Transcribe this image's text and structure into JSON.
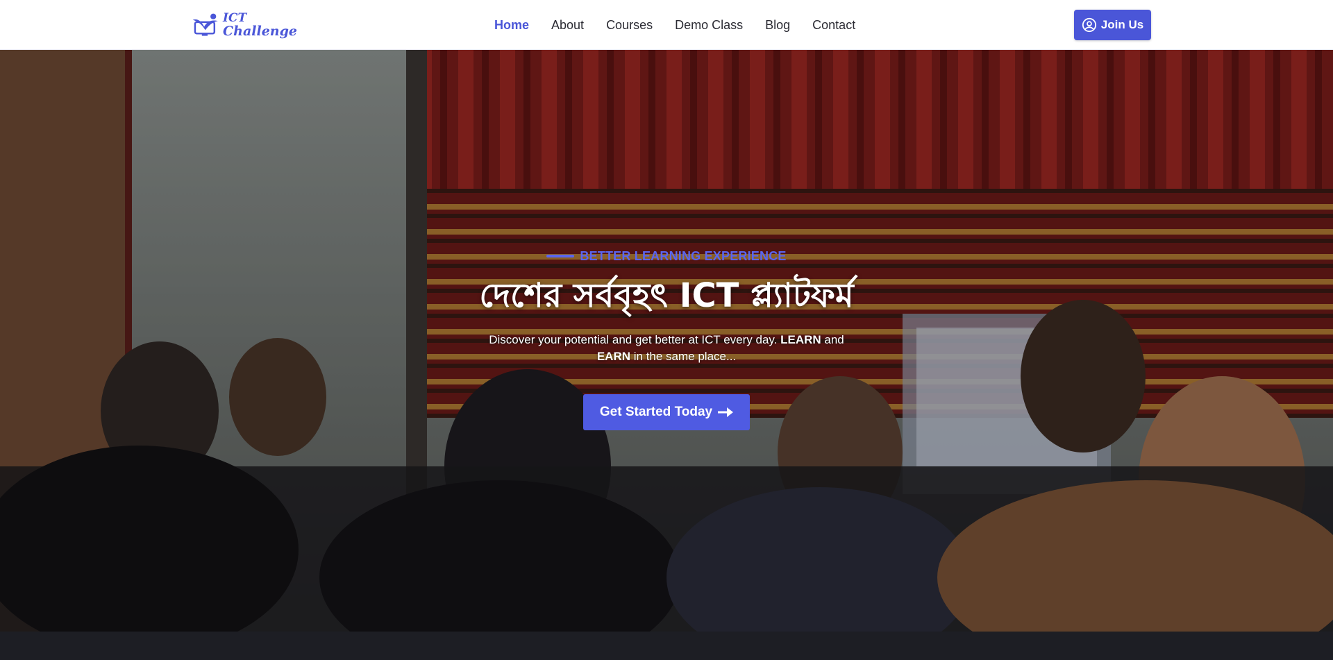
{
  "header": {
    "logo": {
      "line1": "ICT",
      "line2": "Challenge"
    },
    "nav": [
      {
        "label": "Home",
        "active": true
      },
      {
        "label": "About",
        "active": false
      },
      {
        "label": "Courses",
        "active": false
      },
      {
        "label": "Demo Class",
        "active": false
      },
      {
        "label": "Blog",
        "active": false
      },
      {
        "label": "Contact",
        "active": false
      }
    ],
    "join_label": "Join Us",
    "join_icon": "user-circle-icon"
  },
  "hero": {
    "eyebrow": "BETTER LEARNING EXPERIENCE",
    "headline": "দেশের সর্ববৃহৎ ICT প্ল্যাটফর্ম",
    "sub_part1": "Discover your potential and get better at ICT every day. ",
    "sub_learn": "LEARN",
    "sub_part2": " and ",
    "sub_earn": "EARN",
    "sub_part3": " in the same place...",
    "cta_label": "Get Started Today",
    "cta_icon": "arrow-right-icon"
  },
  "colors": {
    "brand": "#4a56d8",
    "accent_text": "#5a66f0",
    "nav_text": "#2b2b33"
  }
}
